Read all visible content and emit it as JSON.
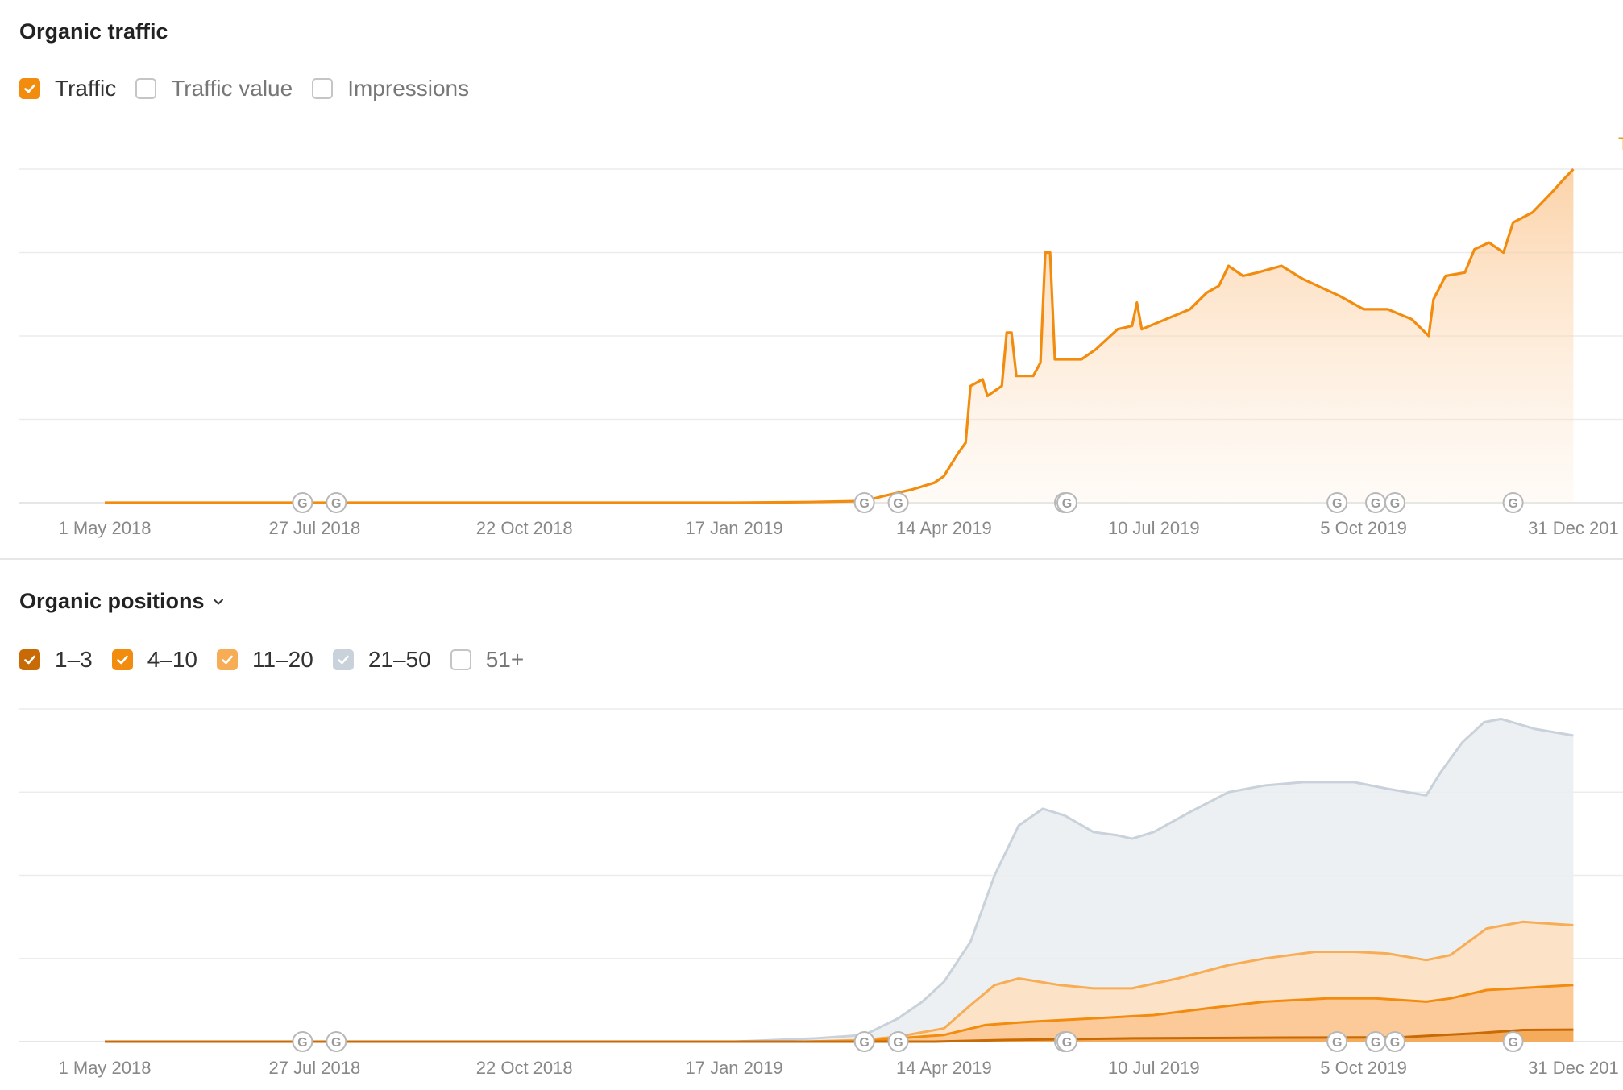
{
  "traffic_panel": {
    "title": "Organic traffic",
    "legend": [
      {
        "label": "Traffic",
        "checked": true,
        "color": "#f28c0f"
      },
      {
        "label": "Traffic value",
        "checked": false,
        "color": "#ffffff"
      },
      {
        "label": "Impressions",
        "checked": false,
        "color": "#ffffff"
      }
    ],
    "corner_marker": "T"
  },
  "positions_panel": {
    "title": "Organic positions",
    "legend": [
      {
        "label": "1–3",
        "checked": true,
        "color": "#c86a05"
      },
      {
        "label": "4–10",
        "checked": true,
        "color": "#f28c0f"
      },
      {
        "label": "11–20",
        "checked": true,
        "color": "#f7ad55"
      },
      {
        "label": "21–50",
        "checked": true,
        "color": "#c9d1da"
      },
      {
        "label": "51+",
        "checked": false,
        "color": "#ffffff"
      }
    ]
  },
  "update_marker_label": "G",
  "chart_data": [
    {
      "type": "area",
      "title": "Organic traffic",
      "x_ticks": [
        "1 May 2018",
        "27 Jul 2018",
        "22 Oct 2018",
        "17 Jan 2019",
        "14 Apr 2019",
        "10 Jul 2019",
        "5 Oct 2019",
        "31 Dec 201"
      ],
      "ylim": [
        0,
        100
      ],
      "grid": true,
      "google_update_dates": [
        "2018-07-22",
        "2018-08-05",
        "2019-03-12",
        "2019-03-26",
        "2019-06-03",
        "2019-06-04",
        "2019-09-24",
        "2019-10-10",
        "2019-10-18",
        "2019-12-06"
      ],
      "series": [
        {
          "name": "Traffic",
          "color": "#f28c0f",
          "points": [
            [
              "2018-05-01",
              0
            ],
            [
              "2019-01-17",
              0
            ],
            [
              "2019-02-17",
              0.2
            ],
            [
              "2019-03-12",
              0.5
            ],
            [
              "2019-03-20",
              2
            ],
            [
              "2019-04-01",
              4
            ],
            [
              "2019-04-10",
              6
            ],
            [
              "2019-04-14",
              8
            ],
            [
              "2019-04-20",
              15
            ],
            [
              "2019-04-23",
              18
            ],
            [
              "2019-04-25",
              35
            ],
            [
              "2019-04-30",
              37
            ],
            [
              "2019-05-02",
              32
            ],
            [
              "2019-05-08",
              35
            ],
            [
              "2019-05-10",
              51
            ],
            [
              "2019-05-12",
              51
            ],
            [
              "2019-05-14",
              38
            ],
            [
              "2019-05-21",
              38
            ],
            [
              "2019-05-24",
              42
            ],
            [
              "2019-05-26",
              75
            ],
            [
              "2019-05-28",
              75
            ],
            [
              "2019-05-30",
              43
            ],
            [
              "2019-06-10",
              43
            ],
            [
              "2019-06-16",
              46
            ],
            [
              "2019-06-25",
              52
            ],
            [
              "2019-07-01",
              53
            ],
            [
              "2019-07-03",
              60
            ],
            [
              "2019-07-05",
              52
            ],
            [
              "2019-07-15",
              55
            ],
            [
              "2019-07-25",
              58
            ],
            [
              "2019-08-01",
              63
            ],
            [
              "2019-08-06",
              65
            ],
            [
              "2019-08-10",
              71
            ],
            [
              "2019-08-16",
              68
            ],
            [
              "2019-08-22",
              69
            ],
            [
              "2019-09-01",
              71
            ],
            [
              "2019-09-10",
              67
            ],
            [
              "2019-09-25",
              62
            ],
            [
              "2019-10-05",
              58
            ],
            [
              "2019-10-15",
              58
            ],
            [
              "2019-10-25",
              55
            ],
            [
              "2019-11-01",
              50
            ],
            [
              "2019-11-03",
              61
            ],
            [
              "2019-11-08",
              68
            ],
            [
              "2019-11-16",
              69
            ],
            [
              "2019-11-20",
              76
            ],
            [
              "2019-11-26",
              78
            ],
            [
              "2019-12-02",
              75
            ],
            [
              "2019-12-06",
              84
            ],
            [
              "2019-12-14",
              87
            ],
            [
              "2019-12-22",
              93
            ],
            [
              "2019-12-27",
              97
            ],
            [
              "2019-12-31",
              100
            ]
          ]
        }
      ]
    },
    {
      "type": "area",
      "title": "Organic positions",
      "x_ticks": [
        "1 May 2018",
        "27 Jul 2018",
        "22 Oct 2018",
        "17 Jan 2019",
        "14 Apr 2019",
        "10 Jul 2019",
        "5 Oct 2019",
        "31 Dec 201"
      ],
      "ylim": [
        0,
        100
      ],
      "grid": true,
      "stacked": true,
      "series": [
        {
          "name": "21–50",
          "color": "#c9d1da",
          "fill": "#ebeef2",
          "points": [
            [
              "2018-05-01",
              0
            ],
            [
              "2019-01-17",
              0
            ],
            [
              "2019-02-20",
              1
            ],
            [
              "2019-03-12",
              2
            ],
            [
              "2019-03-26",
              7
            ],
            [
              "2019-04-05",
              12
            ],
            [
              "2019-04-14",
              18
            ],
            [
              "2019-04-25",
              30
            ],
            [
              "2019-05-05",
              50
            ],
            [
              "2019-05-15",
              65
            ],
            [
              "2019-05-25",
              70
            ],
            [
              "2019-06-03",
              68
            ],
            [
              "2019-06-15",
              63
            ],
            [
              "2019-06-25",
              62
            ],
            [
              "2019-07-01",
              61
            ],
            [
              "2019-07-10",
              63
            ],
            [
              "2019-07-25",
              69
            ],
            [
              "2019-08-10",
              75
            ],
            [
              "2019-08-25",
              77
            ],
            [
              "2019-09-10",
              78
            ],
            [
              "2019-10-01",
              78
            ],
            [
              "2019-10-15",
              76
            ],
            [
              "2019-10-31",
              74
            ],
            [
              "2019-11-06",
              81
            ],
            [
              "2019-11-15",
              90
            ],
            [
              "2019-11-24",
              96
            ],
            [
              "2019-12-01",
              97
            ],
            [
              "2019-12-15",
              94
            ],
            [
              "2019-12-31",
              92
            ]
          ]
        },
        {
          "name": "11–20",
          "color": "#f7ad55",
          "fill": "#fde0c2",
          "points": [
            [
              "2018-05-01",
              0
            ],
            [
              "2019-02-15",
              0
            ],
            [
              "2019-03-12",
              0.5
            ],
            [
              "2019-03-26",
              1.5
            ],
            [
              "2019-04-14",
              4
            ],
            [
              "2019-04-25",
              11
            ],
            [
              "2019-05-05",
              17
            ],
            [
              "2019-05-15",
              19
            ],
            [
              "2019-06-01",
              17
            ],
            [
              "2019-06-15",
              16
            ],
            [
              "2019-07-01",
              16
            ],
            [
              "2019-07-20",
              19
            ],
            [
              "2019-08-10",
              23
            ],
            [
              "2019-08-25",
              25
            ],
            [
              "2019-09-15",
              27
            ],
            [
              "2019-10-01",
              27
            ],
            [
              "2019-10-15",
              26.5
            ],
            [
              "2019-10-31",
              24.5
            ],
            [
              "2019-11-10",
              26
            ],
            [
              "2019-11-25",
              34
            ],
            [
              "2019-12-10",
              36
            ],
            [
              "2019-12-31",
              35
            ]
          ]
        },
        {
          "name": "4–10",
          "color": "#f28c0f",
          "fill": "#fcc894",
          "points": [
            [
              "2018-05-01",
              0
            ],
            [
              "2019-03-10",
              0
            ],
            [
              "2019-03-26",
              1
            ],
            [
              "2019-04-14",
              2
            ],
            [
              "2019-05-01",
              5
            ],
            [
              "2019-05-20",
              6
            ],
            [
              "2019-06-15",
              7
            ],
            [
              "2019-07-10",
              8
            ],
            [
              "2019-08-01",
              10
            ],
            [
              "2019-08-25",
              12
            ],
            [
              "2019-09-20",
              13
            ],
            [
              "2019-10-10",
              13
            ],
            [
              "2019-10-31",
              12
            ],
            [
              "2019-11-10",
              13
            ],
            [
              "2019-11-25",
              15.5
            ],
            [
              "2019-12-31",
              17
            ]
          ]
        },
        {
          "name": "1–3",
          "color": "#c86a05",
          "fill": "#f3a955",
          "points": [
            [
              "2018-05-01",
              0
            ],
            [
              "2019-04-10",
              0
            ],
            [
              "2019-05-10",
              0.5
            ],
            [
              "2019-07-01",
              1
            ],
            [
              "2019-09-01",
              1.2
            ],
            [
              "2019-10-20",
              1.3
            ],
            [
              "2019-11-20",
              2.5
            ],
            [
              "2019-12-10",
              3.5
            ],
            [
              "2019-12-31",
              3.6
            ]
          ]
        }
      ]
    }
  ]
}
